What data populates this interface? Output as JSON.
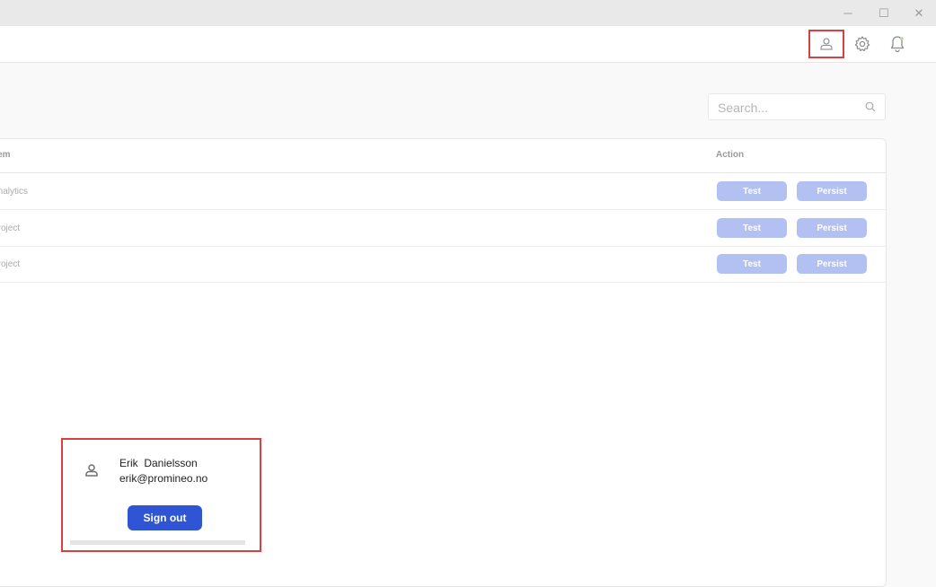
{
  "window": {
    "minimize": "─",
    "maximize": "☐",
    "close": "✕"
  },
  "search": {
    "placeholder": "Search..."
  },
  "table": {
    "columns": {
      "item": "Item",
      "action": "Action"
    },
    "rows": [
      {
        "item": "Analytics",
        "test": "Test",
        "persist": "Persist"
      },
      {
        "item": "Project",
        "test": "Test",
        "persist": "Persist"
      },
      {
        "item": "Project",
        "test": "Test",
        "persist": "Persist"
      }
    ]
  },
  "user_popup": {
    "name": "Erik  Danielsson",
    "email": "erik@promineo.no",
    "sign_out": "Sign out"
  },
  "colors": {
    "accent": "#2f55d4",
    "button_disabled": "#b3c0f2",
    "highlight": "#d94040"
  }
}
